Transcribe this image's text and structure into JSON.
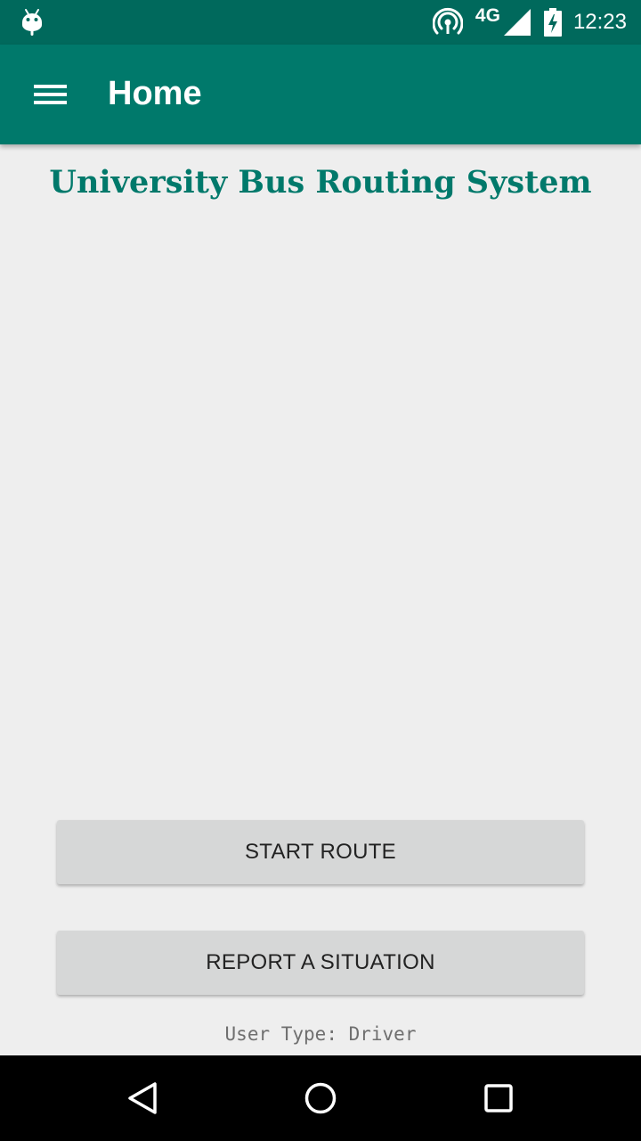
{
  "status_bar": {
    "notification_icon": "android-icon",
    "hotspot_icon": "hotspot-icon",
    "network_type": "4G",
    "signal_icon": "signal-icon",
    "battery_icon": "battery-charging-icon",
    "time": "12:23"
  },
  "app_bar": {
    "menu_icon": "hamburger-menu-icon",
    "title": "Home"
  },
  "main": {
    "heading": "University Bus Routing System",
    "buttons": {
      "start_route": "START ROUTE",
      "report_situation": "REPORT A SITUATION"
    },
    "user_type": "User Type: Driver"
  },
  "nav_bar": {
    "back_icon": "back-icon",
    "home_icon": "home-icon",
    "recents_icon": "recents-icon"
  },
  "colors": {
    "status_bar": "#00695c",
    "app_bar": "#00796b",
    "accent_text": "#00796b",
    "background": "#eeeeee",
    "button": "#d6d7d7"
  }
}
